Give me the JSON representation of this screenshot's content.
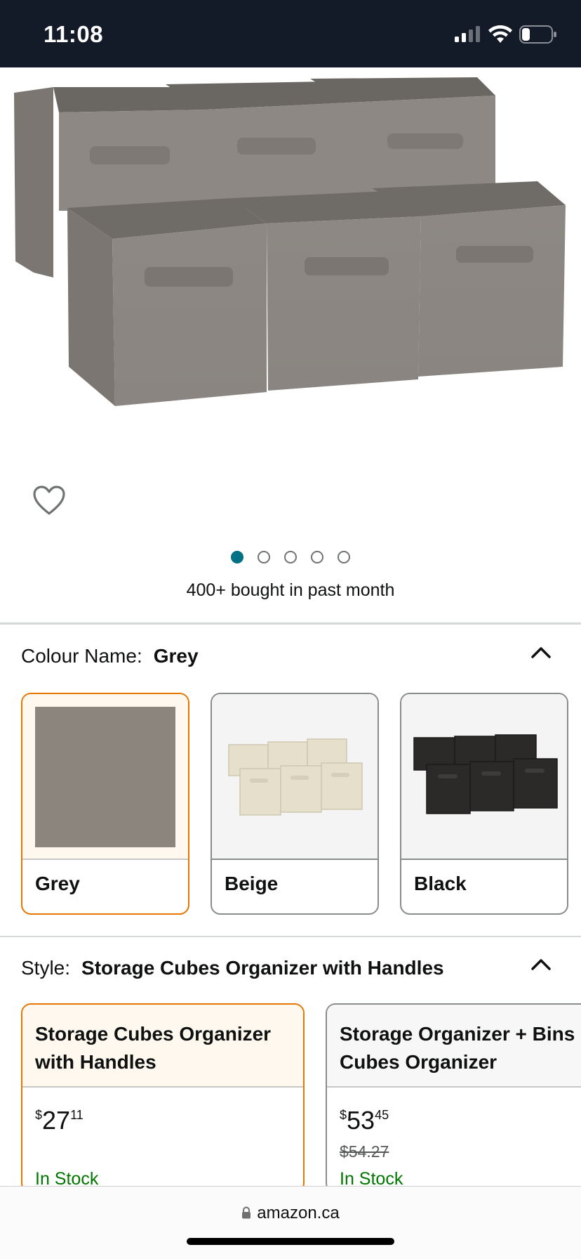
{
  "status_bar": {
    "time": "11:08"
  },
  "product": {
    "bought_text": "400+ bought in past month",
    "image_count": 5,
    "active_image": 1
  },
  "colour": {
    "label": "Colour Name:",
    "selected": "Grey",
    "options": [
      {
        "name": "Grey"
      },
      {
        "name": "Beige"
      },
      {
        "name": "Black"
      }
    ]
  },
  "style": {
    "label": "Style:",
    "selected": "Storage Cubes Organizer with Handles",
    "options": [
      {
        "title_line1": "Storage Cubes Organizer",
        "title_line2": "with Handles",
        "price_currency": "$",
        "price_whole": "27",
        "price_fraction": "11",
        "was_price": "",
        "availability": "In Stock"
      },
      {
        "title_line1": "Storage Organizer + Bins",
        "title_line2": "Cubes Organizer",
        "price_currency": "$",
        "price_whole": "53",
        "price_fraction": "45",
        "was_price": "$54.27",
        "availability": "In Stock"
      }
    ]
  },
  "browser": {
    "url": "amazon.ca"
  },
  "colors": {
    "status_bar_bg": "#131a28",
    "selected_border": "#e77600",
    "active_dot": "#007185",
    "in_stock": "#007600"
  }
}
